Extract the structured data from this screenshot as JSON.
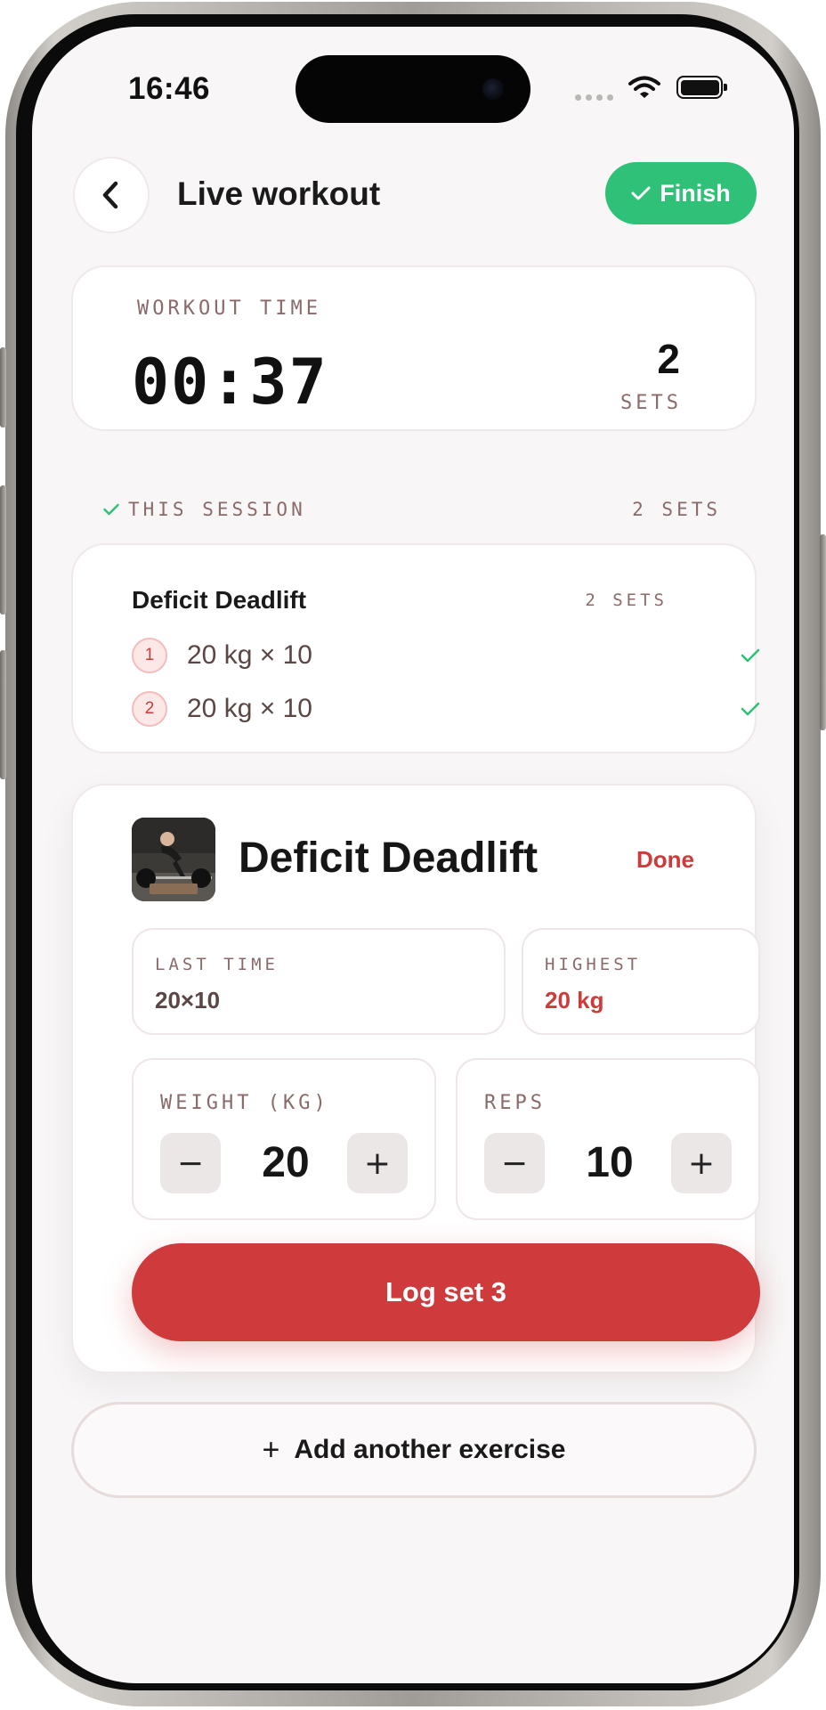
{
  "status_bar": {
    "time": "16:46"
  },
  "header": {
    "title": "Live workout",
    "finish_label": "Finish"
  },
  "timer": {
    "label": "WORKOUT TIME",
    "value": "00:37",
    "sets_count": "2",
    "sets_label": "SETS"
  },
  "session": {
    "label": "THIS SESSION",
    "count": "2 SETS",
    "log": {
      "exercise": "Deficit Deadlift",
      "sets_label": "2 SETS",
      "sets": [
        {
          "number": "1",
          "text": "20 kg × 10"
        },
        {
          "number": "2",
          "text": "20 kg × 10"
        }
      ]
    }
  },
  "exercise": {
    "name": "Deficit Deadlift",
    "done_label": "Done",
    "last_time": {
      "label": "LAST TIME",
      "value": "20×10"
    },
    "highest": {
      "label": "HIGHEST",
      "value": "20 kg"
    },
    "weight": {
      "label": "WEIGHT (KG)",
      "value": "20",
      "minus": "−",
      "plus": "+"
    },
    "reps": {
      "label": "REPS",
      "value": "10",
      "minus": "−",
      "plus": "+"
    },
    "log_button": "Log set 3"
  },
  "add_exercise": {
    "icon": "+",
    "label": "Add another exercise"
  },
  "colors": {
    "accent": "#cf3a3c",
    "success": "#2fc178",
    "muted_label": "#8a6a6a"
  }
}
